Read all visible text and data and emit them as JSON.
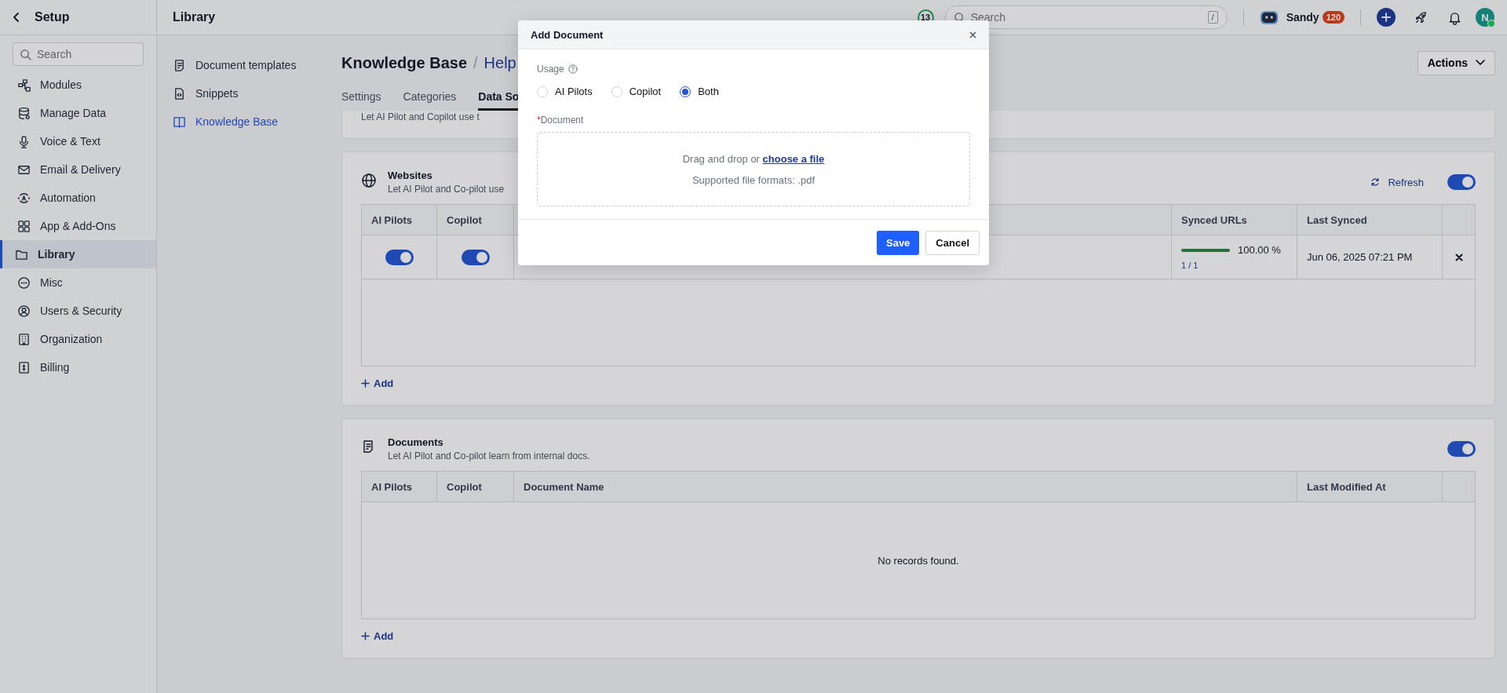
{
  "sidebar": {
    "title": "Setup",
    "search_placeholder": "Search",
    "items": [
      {
        "label": "Modules",
        "kind": "modules",
        "selected": false
      },
      {
        "label": "Manage Data",
        "kind": "database",
        "selected": false
      },
      {
        "label": "Voice & Text",
        "kind": "mic",
        "selected": false
      },
      {
        "label": "Email & Delivery",
        "kind": "mail",
        "selected": false
      },
      {
        "label": "Automation",
        "kind": "automation",
        "selected": false
      },
      {
        "label": "App & Add-Ons",
        "kind": "grid",
        "selected": false
      },
      {
        "label": "Library",
        "kind": "folder",
        "selected": true
      },
      {
        "label": "Misc",
        "kind": "more",
        "selected": false
      },
      {
        "label": "Users & Security",
        "kind": "user",
        "selected": false
      },
      {
        "label": "Organization",
        "kind": "building",
        "selected": false
      },
      {
        "label": "Billing",
        "kind": "billing",
        "selected": false
      }
    ]
  },
  "topbar": {
    "title": "Library",
    "notifications": "13",
    "search_placeholder": "Search",
    "shortcut": "/",
    "user": "Sandy",
    "user_badge": "120",
    "avatar": "N"
  },
  "subnav": [
    {
      "label": "Document templates",
      "kind": "doc",
      "selected": false
    },
    {
      "label": "Snippets",
      "kind": "code",
      "selected": false
    },
    {
      "label": "Knowledge Base",
      "kind": "book",
      "selected": true
    }
  ],
  "page": {
    "title": "Knowledge Base",
    "separator": "/",
    "crumb": "Help",
    "actions": "Actions"
  },
  "tabs": [
    {
      "label": "Settings",
      "selected": false
    },
    {
      "label": "Categories",
      "selected": false
    },
    {
      "label": "Data So",
      "selected": true
    }
  ],
  "cut_card": {
    "description": "Let AI Pilot and Copilot use t"
  },
  "websites": {
    "title": "Websites",
    "description": "Let AI Pilot and Co-pilot use",
    "refresh": "Refresh",
    "enabled": true,
    "columns": {
      "ai_pilots": "AI Pilots",
      "copilot": "Copilot",
      "synced_urls": "Synced URLs",
      "last_synced": "Last Synced"
    },
    "rows": [
      {
        "ai_pilots": true,
        "copilot": true,
        "synced": "100.00 %",
        "level": 1,
        "count": "1 / 1",
        "last_synced": "Jun 06, 2025 07:21 PM"
      }
    ],
    "add": "Add"
  },
  "documents": {
    "title": "Documents",
    "description": "Let AI Pilot and Co-pilot learn from internal docs.",
    "enabled": true,
    "columns": {
      "ai_pilots": "AI Pilots",
      "copilot": "Copilot",
      "document_name": "Document Name",
      "last_modified": "Last Modified At"
    },
    "empty": "No records found.",
    "add": "Add"
  },
  "modal": {
    "title": "Add Document",
    "usage_label": "Usage",
    "usage_options": [
      {
        "label": "AI Pilots",
        "selected": false
      },
      {
        "label": "Copilot",
        "selected": false
      },
      {
        "label": "Both",
        "selected": true
      }
    ],
    "required_mark": "*",
    "document_label": "Document",
    "drop_text": "Drag and drop or ",
    "drop_link": "choose a file",
    "formats": "Supported file formats: .pdf",
    "save": "Save",
    "cancel": "Cancel"
  }
}
